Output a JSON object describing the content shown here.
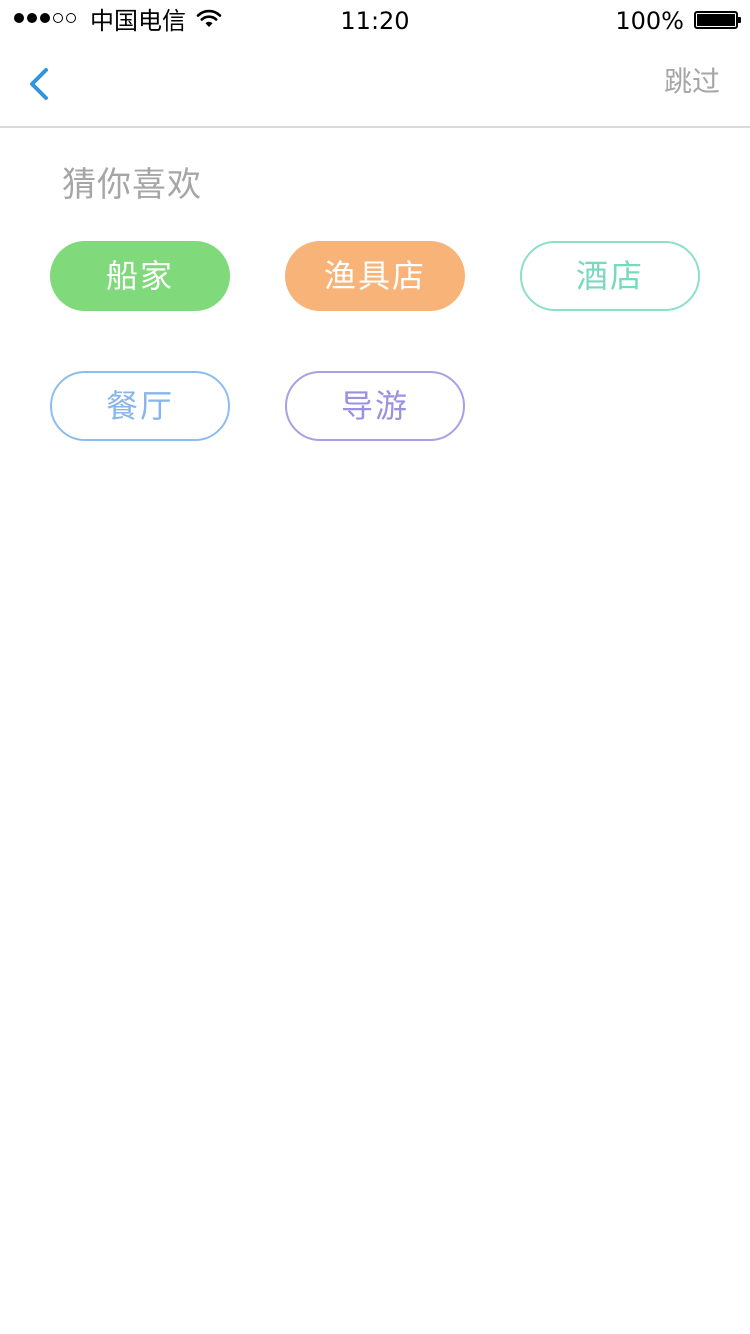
{
  "status_bar": {
    "carrier": "中国电信",
    "time": "11:20",
    "battery": "100%",
    "signal_icon": "signal-dots-icon",
    "wifi_icon": "wifi-icon",
    "battery_icon": "battery-icon"
  },
  "nav": {
    "back_icon": "chevron-left-icon",
    "back_color": "#2f95e0",
    "skip_label": "跳过"
  },
  "section": {
    "title": "猜你喜欢"
  },
  "tags": [
    {
      "label": "船家",
      "style": "filled",
      "color": "#80d97a"
    },
    {
      "label": "渔具店",
      "style": "filled",
      "color": "#f7b378"
    },
    {
      "label": "酒店",
      "style": "outline",
      "color": "#8ce0c9"
    },
    {
      "label": "餐厅",
      "style": "outline",
      "color": "#8dbdf0"
    },
    {
      "label": "导游",
      "style": "outline",
      "color": "#a7a0e6"
    }
  ]
}
